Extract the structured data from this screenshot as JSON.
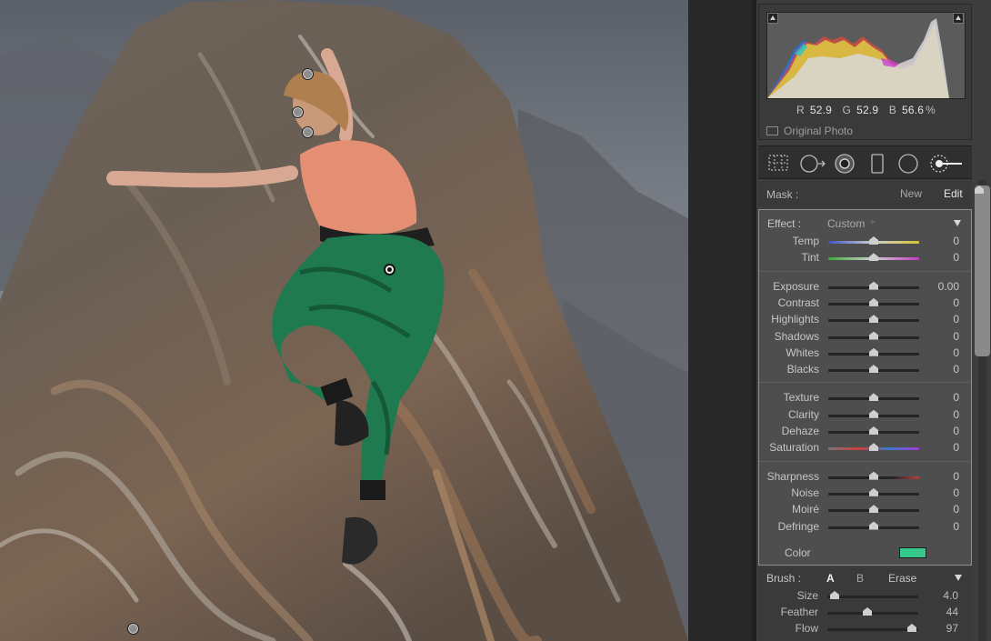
{
  "histogram": {
    "readout": [
      {
        "channel": "R",
        "value": "52.9"
      },
      {
        "channel": "G",
        "value": "52.9"
      },
      {
        "channel": "B",
        "value": "56.6"
      }
    ],
    "unit": "%",
    "original_photo_label": "Original Photo"
  },
  "tools": [
    {
      "name": "crop-overlay-icon"
    },
    {
      "name": "spot-removal-icon"
    },
    {
      "name": "red-eye-icon"
    },
    {
      "name": "graduated-filter-icon"
    },
    {
      "name": "radial-filter-icon"
    },
    {
      "name": "adjustment-brush-icon"
    }
  ],
  "mask": {
    "label": "Mask :",
    "new_label": "New",
    "edit_label": "Edit"
  },
  "effect": {
    "label": "Effect :",
    "preset": "Custom",
    "preset_arrows": "÷",
    "swatch_color": "#34c88a",
    "color_label": "Color",
    "groups": [
      [
        {
          "name": "Temp",
          "value": "0",
          "pos": 0.5
        },
        {
          "name": "Tint",
          "value": "0",
          "pos": 0.5
        }
      ],
      [
        {
          "name": "Exposure",
          "value": "0.00",
          "pos": 0.5
        },
        {
          "name": "Contrast",
          "value": "0",
          "pos": 0.5
        },
        {
          "name": "Highlights",
          "value": "0",
          "pos": 0.5
        },
        {
          "name": "Shadows",
          "value": "0",
          "pos": 0.5
        },
        {
          "name": "Whites",
          "value": "0",
          "pos": 0.5
        },
        {
          "name": "Blacks",
          "value": "0",
          "pos": 0.5
        }
      ],
      [
        {
          "name": "Texture",
          "value": "0",
          "pos": 0.5
        },
        {
          "name": "Clarity",
          "value": "0",
          "pos": 0.5
        },
        {
          "name": "Dehaze",
          "value": "0",
          "pos": 0.5
        },
        {
          "name": "Saturation",
          "value": "0",
          "pos": 0.5
        }
      ],
      [
        {
          "name": "Sharpness",
          "value": "0",
          "pos": 0.5
        },
        {
          "name": "Noise",
          "value": "0",
          "pos": 0.5
        },
        {
          "name": "Moiré",
          "value": "0",
          "pos": 0.5
        },
        {
          "name": "Defringe",
          "value": "0",
          "pos": 0.5
        }
      ]
    ]
  },
  "brush": {
    "label": "Brush :",
    "a_label": "A",
    "b_label": "B",
    "erase_label": "Erase",
    "sliders": [
      {
        "name": "Size",
        "value": "4.0",
        "pos": 0.08
      },
      {
        "name": "Feather",
        "value": "44",
        "pos": 0.44
      },
      {
        "name": "Flow",
        "value": "97",
        "pos": 0.93
      }
    ]
  },
  "pins": [
    {
      "active": false
    },
    {
      "active": false
    },
    {
      "active": false
    },
    {
      "active": true
    },
    {
      "active": false
    }
  ]
}
